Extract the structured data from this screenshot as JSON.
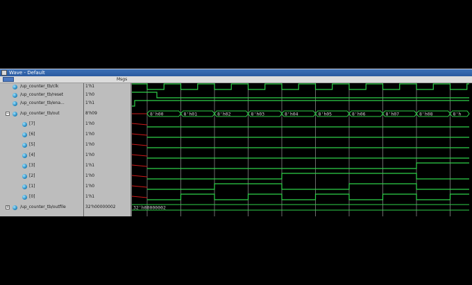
{
  "window": {
    "title": "Wave - Default"
  },
  "toolbar": {
    "msgs_label": "Msgs"
  },
  "signals": [
    {
      "name": "/up_counter_tb/clk",
      "value": "1'h1",
      "kind": "top"
    },
    {
      "name": "/up_counter_tb/reset",
      "value": "1'h0",
      "kind": "top"
    },
    {
      "name": "/up_counter_tb/ena...",
      "value": "1'h1",
      "kind": "top"
    },
    {
      "name": "/up_counter_tb/out",
      "value": "8'h09",
      "kind": "bus"
    },
    {
      "name": "[7]",
      "value": "1'h0",
      "kind": "bit"
    },
    {
      "name": "[6]",
      "value": "1'h0",
      "kind": "bit"
    },
    {
      "name": "[5]",
      "value": "1'h0",
      "kind": "bit"
    },
    {
      "name": "[4]",
      "value": "1'h0",
      "kind": "bit"
    },
    {
      "name": "[3]",
      "value": "1'h1",
      "kind": "bit"
    },
    {
      "name": "[2]",
      "value": "1'h0",
      "kind": "bit"
    },
    {
      "name": "[1]",
      "value": "1'h0",
      "kind": "bit"
    },
    {
      "name": "[0]",
      "value": "1'h1",
      "kind": "bit"
    },
    {
      "name": "/up_counter_tb/outfile",
      "value": "32'h00000002",
      "kind": "bus"
    }
  ],
  "bus_values": [
    "8'h00",
    "8'h01",
    "8'h02",
    "8'h03",
    "8'h04",
    "8'h05",
    "8'h06",
    "8'h07",
    "8'h08",
    "8'h"
  ],
  "outfile_value": "32'h00000002",
  "colors": {
    "wave": "#2fd24a",
    "grid": "#6b6b6b",
    "undefined": "#d11a1a",
    "bus_text": "#d8d8d8"
  }
}
